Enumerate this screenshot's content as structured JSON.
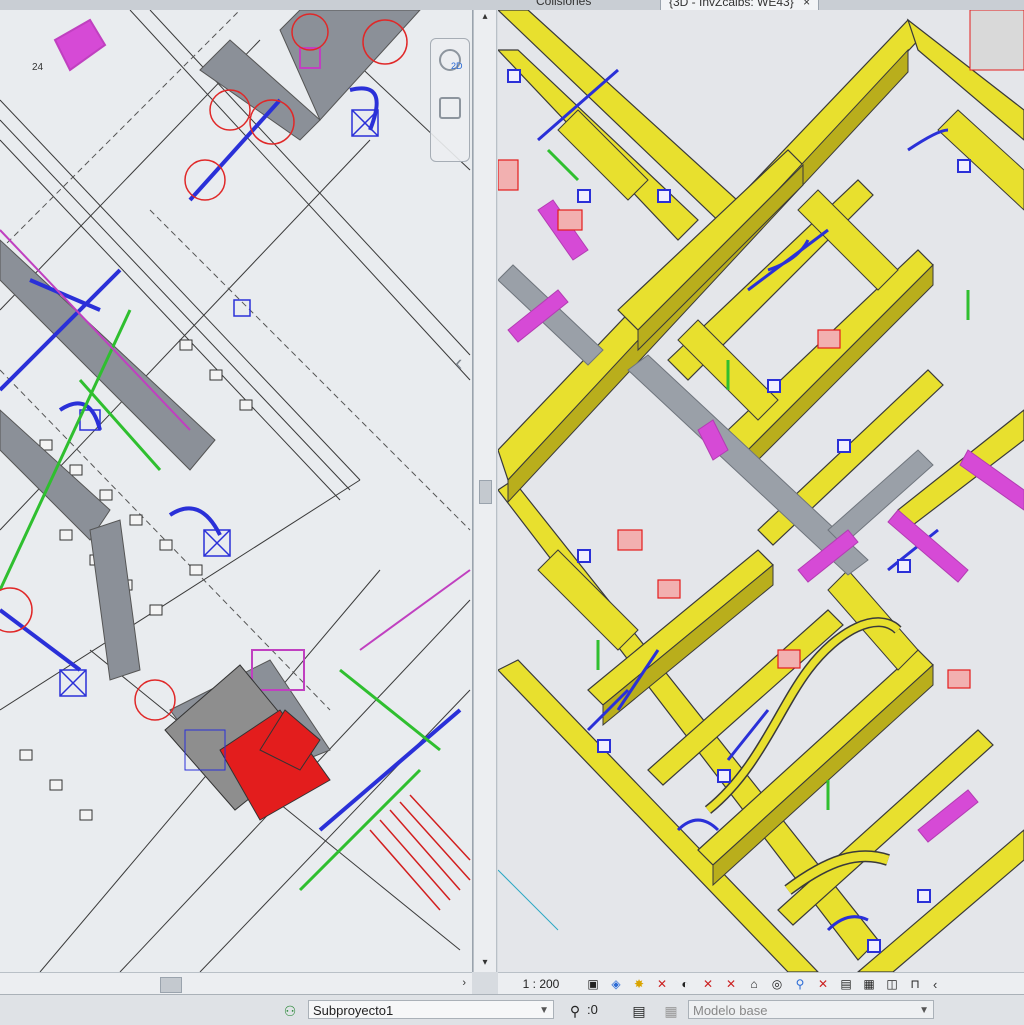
{
  "tabs": [
    {
      "label": "Colisiones",
      "active": false
    },
    {
      "label": "{3D - InvZcalbs: WE43}",
      "active": true,
      "close": "×"
    }
  ],
  "left_view": {
    "room_label": "24",
    "navwheel_label": "2D",
    "chevron": "‹"
  },
  "right_view": {
    "scale": "1 : 200",
    "more": "‹"
  },
  "status": {
    "workset": "Subproyecto1",
    "editable_count": ":0",
    "design_option": "Modelo base"
  },
  "colors": {
    "wall": "#e8e02e",
    "wall_dark": "#9c9313",
    "duct_gray": "#8b9098",
    "duct_blue": "#2a30d8",
    "duct_magenta": "#d64ad6",
    "pipe_green": "#2fbf2f",
    "highlight_red": "#e31d1d",
    "revision_cloud": "#e02828"
  },
  "icons": [
    "workset-icon",
    "editable-icon",
    "design-option-icon",
    "model-icon"
  ]
}
